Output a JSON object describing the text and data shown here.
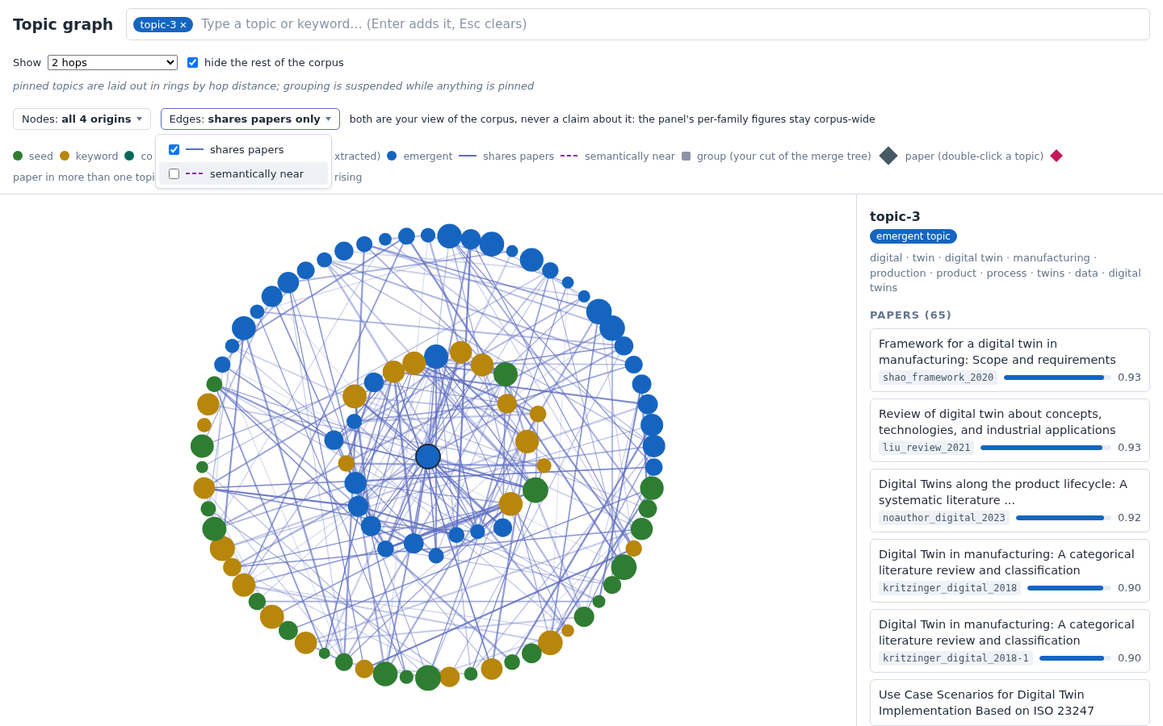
{
  "title": "Topic graph",
  "search": {
    "chips": [
      {
        "label": "topic-3",
        "remove": "×"
      }
    ],
    "placeholder": "Type a topic or keyword… (Enter adds it, Esc clears)"
  },
  "show": {
    "label": "Show",
    "value": "2 hops",
    "hide_rest": {
      "label": "hide the rest of the corpus",
      "checked": true
    }
  },
  "note": "pinned topics are laid out in rings by hop distance; grouping is suspended while anything is pinned",
  "filters": [
    {
      "label": "Nodes: **all 4 origins**",
      "open": false
    },
    {
      "label": "Edges: **shares papers only**",
      "open": true
    }
  ],
  "filters_note": "both are your view of the corpus, never a claim about it: the panel's per-family figures stay corpus-wide",
  "edge_menu": [
    {
      "label": "shares papers",
      "kind": "line",
      "color": "#5c6bc0",
      "checked": true,
      "highlighted": false
    },
    {
      "label": "semantically near",
      "kind": "dashed",
      "color": "#8e24aa",
      "checked": false,
      "highlighted": true
    }
  ],
  "legend": [
    {
      "left": [
        {
          "kind": "dot",
          "color": "#2e7d32",
          "label": "seed"
        },
        {
          "kind": "dot",
          "color": "#b8860b",
          "label": "keyword"
        },
        {
          "kind": "dot",
          "color": "#00695c",
          "label": "co"
        }
      ],
      "right": [
        {
          "kind": "text",
          "label": "xtracted)"
        },
        {
          "kind": "dot",
          "color": "#1565c0",
          "label": "emergent"
        },
        {
          "kind": "line",
          "color": "#5c6bc0",
          "label": "shares papers"
        },
        {
          "kind": "dashed",
          "color": "#8e24aa",
          "label": "semantically near"
        },
        {
          "kind": "square",
          "color": "#8a94a6",
          "label": "group (your cut of the merge tree)"
        },
        {
          "kind": "diamond",
          "color": "#455a64",
          "label": "paper (double-click a topic)"
        },
        {
          "kind": "small-diamond",
          "color": "#c2185b"
        }
      ]
    },
    {
      "left": [
        {
          "kind": "text",
          "label": "paper in more than one topi"
        }
      ],
      "right": [
        {
          "kind": "text",
          "label": "rising"
        }
      ]
    }
  ],
  "panel": {
    "title": "topic-3",
    "badge": "emergent topic",
    "keywords": "digital · twin · digital twin · manufacturing · production · product · process · twins · data · digital twins",
    "papers_heading": "PAPERS (65)",
    "papers": [
      {
        "title": "Framework for a digital twin in manufacturing: Scope and requirements",
        "key": "shao_framework_2020",
        "level": 0.93,
        "score": "0.93"
      },
      {
        "title": "Review of digital twin about concepts, technologies, and industrial applications",
        "key": "liu_review_2021",
        "level": 0.93,
        "score": "0.93"
      },
      {
        "title": "Digital Twins along the product lifecycle: A systematic literature ...",
        "key": "noauthor_digital_2023",
        "level": 0.92,
        "score": "0.92"
      },
      {
        "title": "Digital Twin in manufacturing: A categorical literature review and classification",
        "key": "kritzinger_digital_2018",
        "level": 0.9,
        "score": "0.90"
      },
      {
        "title": "Digital Twin in manufacturing: A categorical literature review and classification",
        "key": "kritzinger_digital_2018-1",
        "level": 0.9,
        "score": "0.90"
      },
      {
        "title": "Use Case Scenarios for Digital Twin Implementation Based on ISO 23247"
      }
    ]
  }
}
